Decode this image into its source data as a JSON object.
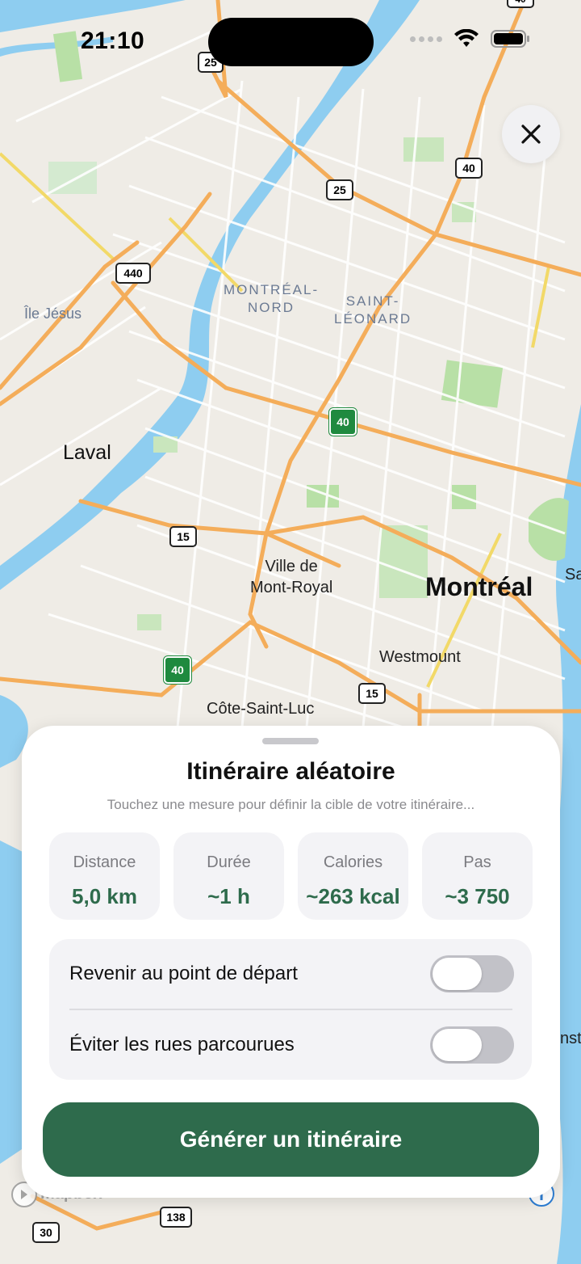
{
  "status_bar": {
    "time": "21:10",
    "icons": [
      "cellular-dots-icon",
      "wifi-icon",
      "battery-icon"
    ]
  },
  "map": {
    "labels": {
      "montreal_nord_1": "MONTRÉAL-",
      "montreal_nord_2": "NORD",
      "saint_leonard_1": "SAINT-",
      "saint_leonard_2": "LÉONARD",
      "ile_jesus": "Île Jésus",
      "laval": "Laval",
      "ville_mont_royal_1": "Ville de",
      "ville_mont_royal_2": "Mont-Royal",
      "montreal": "Montréal",
      "westmount": "Westmount",
      "cote_saint_luc": "Côte-Saint-Luc",
      "edge_sa": "Sa",
      "edge_nst": "nst"
    },
    "shields": {
      "r25a": "25",
      "r25b": "25",
      "r40a": "40",
      "r40b": "40",
      "r440": "440",
      "r15a": "15",
      "r15b": "15",
      "r40g1": "40",
      "r40g2": "40",
      "r138": "138",
      "r30": "30"
    },
    "attribution": "mapbox"
  },
  "close_button": {
    "icon": "close-icon"
  },
  "sheet": {
    "title": "Itinéraire aléatoire",
    "subtitle": "Touchez une mesure pour définir la cible de votre itinéraire...",
    "metrics": [
      {
        "label": "Distance",
        "value": "5,0 km"
      },
      {
        "label": "Durée",
        "value": "~1 h"
      },
      {
        "label": "Calories",
        "value": "~263 kcal"
      },
      {
        "label": "Pas",
        "value": "~3 750"
      }
    ],
    "options": [
      {
        "label": "Revenir au point de départ",
        "enabled": false
      },
      {
        "label": "Éviter les rues parcourues",
        "enabled": false
      }
    ],
    "generate_label": "Générer un itinéraire"
  },
  "colors": {
    "accent": "#2e6b4c",
    "water": "#8ecdf0",
    "highway": "#f4ad5a",
    "park": "#b8e0a6",
    "land": "#efece6"
  }
}
